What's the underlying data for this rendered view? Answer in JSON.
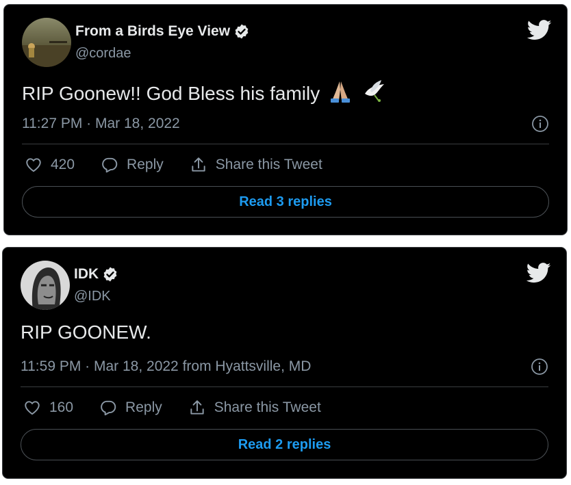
{
  "tweets": [
    {
      "display_name": "From a Birds Eye View",
      "handle": "@cordae",
      "text": "RIP Goonew!! God Bless his family",
      "emojis": [
        "🙏🏼",
        "🕊️"
      ],
      "timestamp": "11:27 PM · Mar 18, 2022",
      "likes": "420",
      "reply_label": "Reply",
      "share_label": "Share this Tweet",
      "read_replies": "Read 3 replies"
    },
    {
      "display_name": "IDK",
      "handle": "@IDK",
      "text": "RIP GOONEW.",
      "emojis": [],
      "timestamp": "11:59 PM · Mar 18, 2022 from Hyattsville, MD",
      "likes": "160",
      "reply_label": "Reply",
      "share_label": "Share this Tweet",
      "read_replies": "Read 2 replies"
    }
  ],
  "colors": {
    "background": "#000000",
    "text": "#e7e9ea",
    "secondary": "#8b98a5",
    "accent": "#1d9bf0",
    "border": "#3a3d40"
  },
  "icons": [
    "verified-badge-icon",
    "twitter-bird-icon",
    "info-icon",
    "heart-icon",
    "reply-bubble-icon",
    "share-icon"
  ]
}
